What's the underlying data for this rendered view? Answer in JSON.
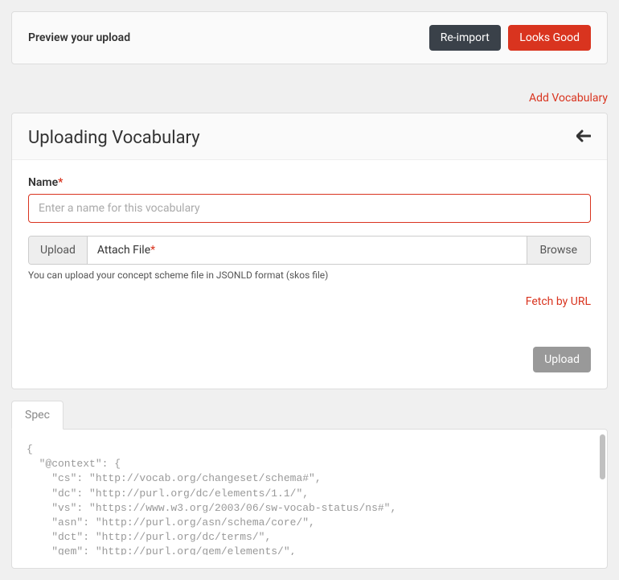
{
  "preview": {
    "title": "Preview your upload",
    "reimport_label": "Re-import",
    "looks_good_label": "Looks Good"
  },
  "add_vocab_label": "Add Vocabulary",
  "upload_panel": {
    "header_title": "Uploading Vocabulary",
    "name_label": "Name",
    "name_placeholder": "Enter a name for this vocabulary",
    "upload_btn_label": "Upload",
    "attach_file_label": "Attach File",
    "browse_label": "Browse",
    "help_text": "You can upload your concept scheme file in JSONLD format (skos file)",
    "fetch_url_label": "Fetch by URL",
    "submit_label": "Upload"
  },
  "tabs": {
    "spec_label": "Spec"
  },
  "spec_content": "{\n  \"@context\": {\n    \"cs\": \"http://vocab.org/changeset/schema#\",\n    \"dc\": \"http://purl.org/dc/elements/1.1/\",\n    \"vs\": \"https://www.w3.org/2003/06/sw-vocab-status/ns#\",\n    \"asn\": \"http://purl.org/asn/schema/core/\",\n    \"dct\": \"http://purl.org/dc/terms/\",\n    \"gem\": \"http://purl.org/gem/elements/\","
}
